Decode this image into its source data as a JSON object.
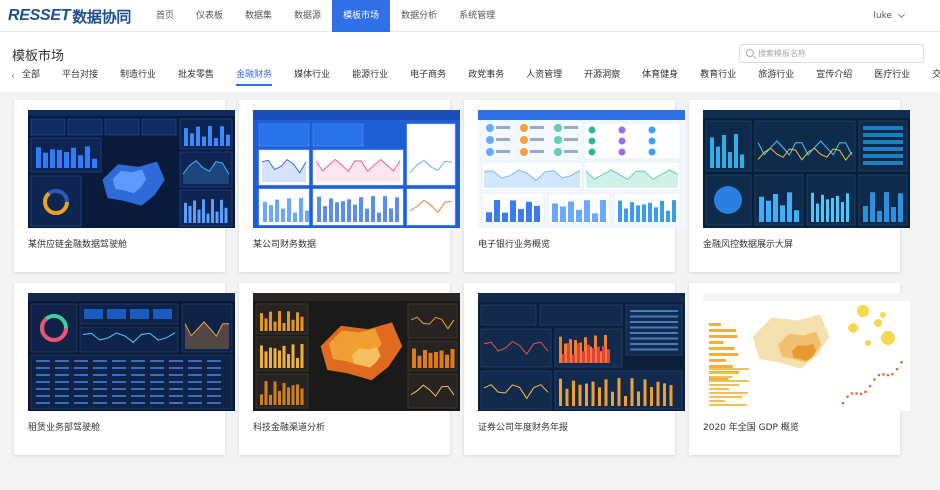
{
  "app": {
    "brand": "RESSET",
    "brand_sub": "数据协同"
  },
  "nav": {
    "items": [
      "首页",
      "仪表板",
      "数据集",
      "数据源",
      "模板市场",
      "数据分析",
      "系统管理"
    ],
    "active": "模板市场"
  },
  "user": {
    "name": "luke"
  },
  "page": {
    "title": "模板市场"
  },
  "search": {
    "placeholder": "搜索模板名称",
    "value": ""
  },
  "categories": {
    "items": [
      "全部",
      "平台对接",
      "制造行业",
      "批发零售",
      "金融财务",
      "媒体行业",
      "能源行业",
      "电子商务",
      "政党事务",
      "人资管理",
      "开源洞察",
      "体育健身",
      "教育行业",
      "旅游行业",
      "宣传介绍",
      "医疗行业",
      "交通运"
    ],
    "active": "金融财务"
  },
  "templates": [
    {
      "title": "某供应链金融数据驾驶舱",
      "thumb": "dark-blue-cockpit"
    },
    {
      "title": "某公司财务数据",
      "thumb": "blue-finance"
    },
    {
      "title": "电子银行业务概览",
      "thumb": "light-bank"
    },
    {
      "title": "金融风控数据展示大屏",
      "thumb": "dark-risk"
    },
    {
      "title": "租赁业务部驾驶舱",
      "thumb": "dark-lease"
    },
    {
      "title": "科技金融渠道分析",
      "thumb": "dark-orange-map"
    },
    {
      "title": "证券公司年度财务年报",
      "thumb": "dark-securities"
    },
    {
      "title": "2020 年全国 GDP 概览",
      "thumb": "light-gdp-map"
    }
  ],
  "colors": {
    "accent": "#2f6fe8",
    "brand": "#1d4f91"
  }
}
